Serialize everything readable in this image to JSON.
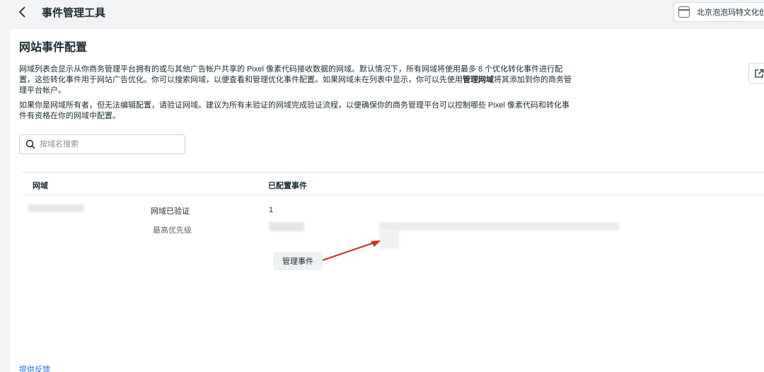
{
  "header": {
    "title": "事件管理工具",
    "account_name": "北京泡泡玛特文化创"
  },
  "panel": {
    "title": "网站事件配置",
    "desc1_part1": "网域列表会显示从你商务管理平台拥有的或与其他广告帐户共享的 Pixel 像素代码接收数据的网域。默认情况下，所有网域将使用最多 8 个优化转化事件进行配置，这些转化事件用于网站广告优化。你可以搜索网域，以便查看和管理优化事件配置。如果网域未在列表中显示，你可以先使用",
    "desc1_bold": "管理网域",
    "desc1_part2": "将其添加到你的商务管理平台帐户。",
    "desc2": "如果你是网域所有者，但无法编辑配置，请验证网域。建议为所有未验证的网域完成验证流程，以便确保你的商务管理平台可以控制哪些 Pixel 像素代码和转化事件有资格在你的网域中配置。"
  },
  "search": {
    "placeholder": "按域名搜索"
  },
  "table": {
    "col_domain": "网域",
    "col_events": "已配置事件",
    "row": {
      "status": "网域已验证",
      "priority_label": "最高优先级",
      "event_count": "1"
    }
  },
  "actions": {
    "manage_events": "管理事件",
    "feedback": "提供反馈"
  },
  "colors": {
    "link": "#216fdb",
    "arrow": "#e02424",
    "background": "#f2f3f5"
  },
  "icons": {
    "back": "chevron-left-icon",
    "account": "window-icon",
    "search": "search-icon",
    "external": "external-link-icon"
  }
}
